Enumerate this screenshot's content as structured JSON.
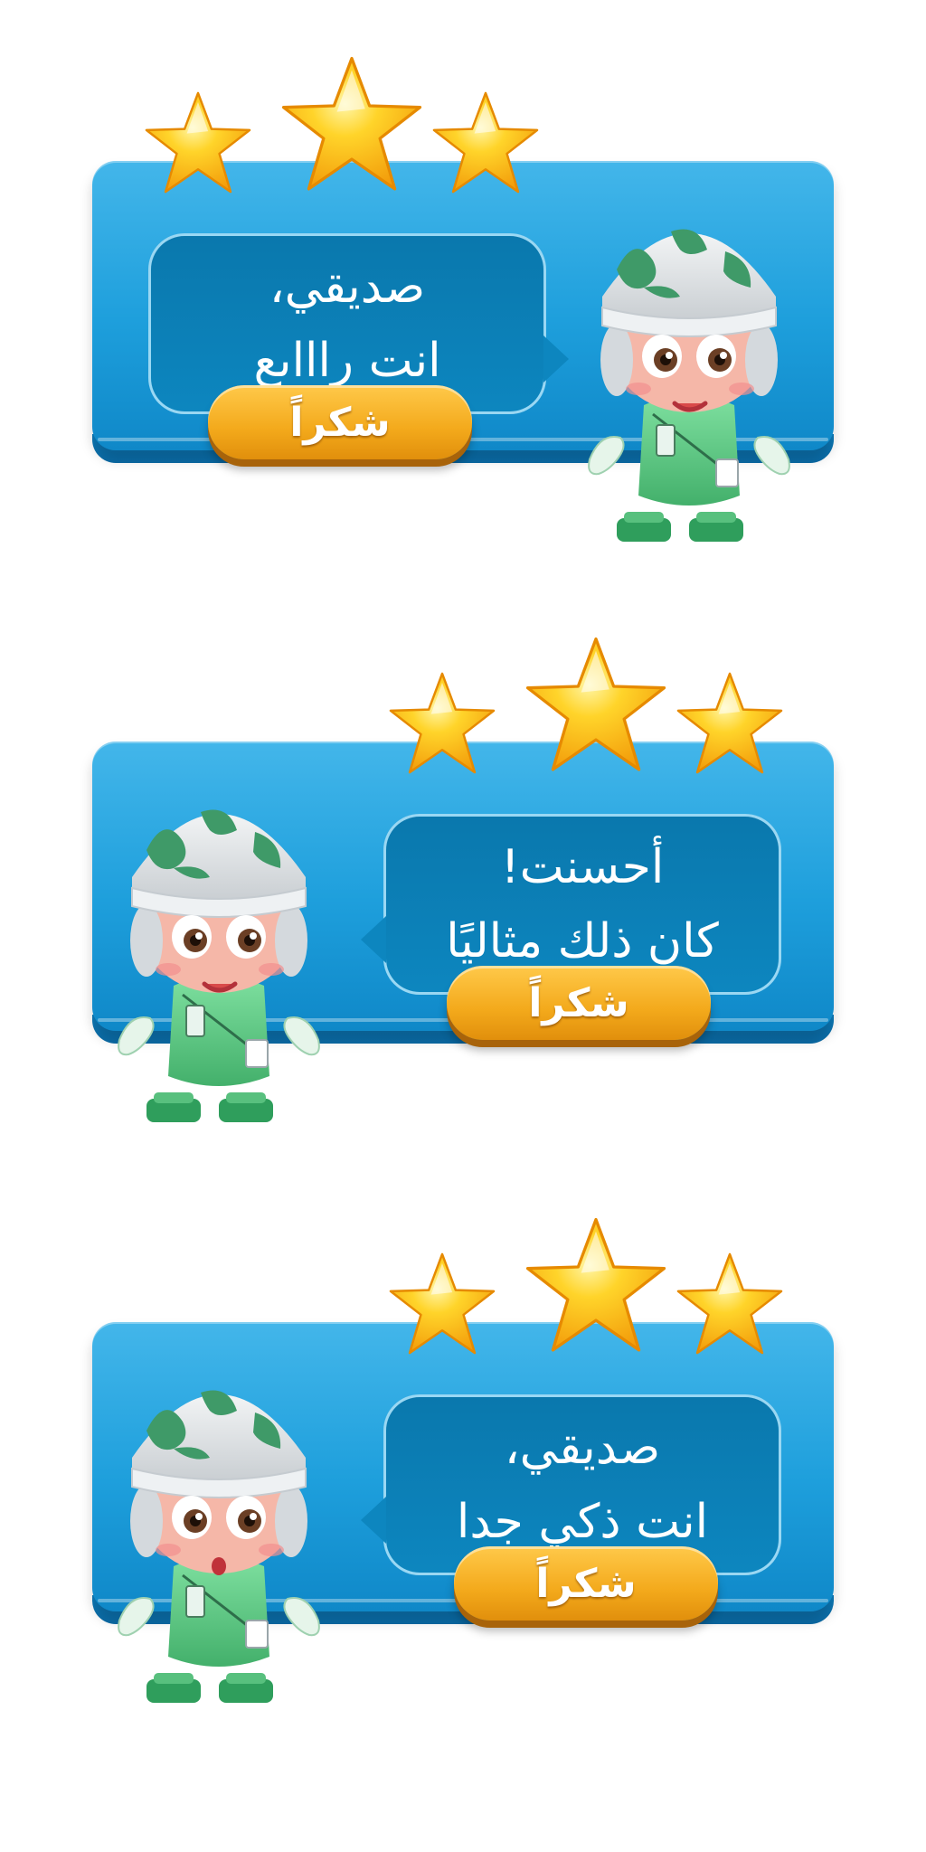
{
  "cards": [
    {
      "line1": "صديقي،",
      "line2": "انت راااىع",
      "button": "شكراً",
      "character_mouth": "smile"
    },
    {
      "line1": "أحسنت!",
      "line2": "كان ذلك مثاليًا",
      "button": "شكراً",
      "character_mouth": "smile"
    },
    {
      "line1": "صديقي،",
      "line2": "انت ذكي جدا",
      "button": "شكراً",
      "character_mouth": "surprised"
    }
  ],
  "rating": {
    "stars": 3,
    "max": 3
  },
  "colors": {
    "panel": "#1e9fdc",
    "bubble": "#0a78ad",
    "button": "#f3a91b",
    "star": "#ffc21a",
    "outfit_green": "#5cc782",
    "skin": "#f5b7a8"
  },
  "icons": [
    "star-icon",
    "character-avatar"
  ]
}
